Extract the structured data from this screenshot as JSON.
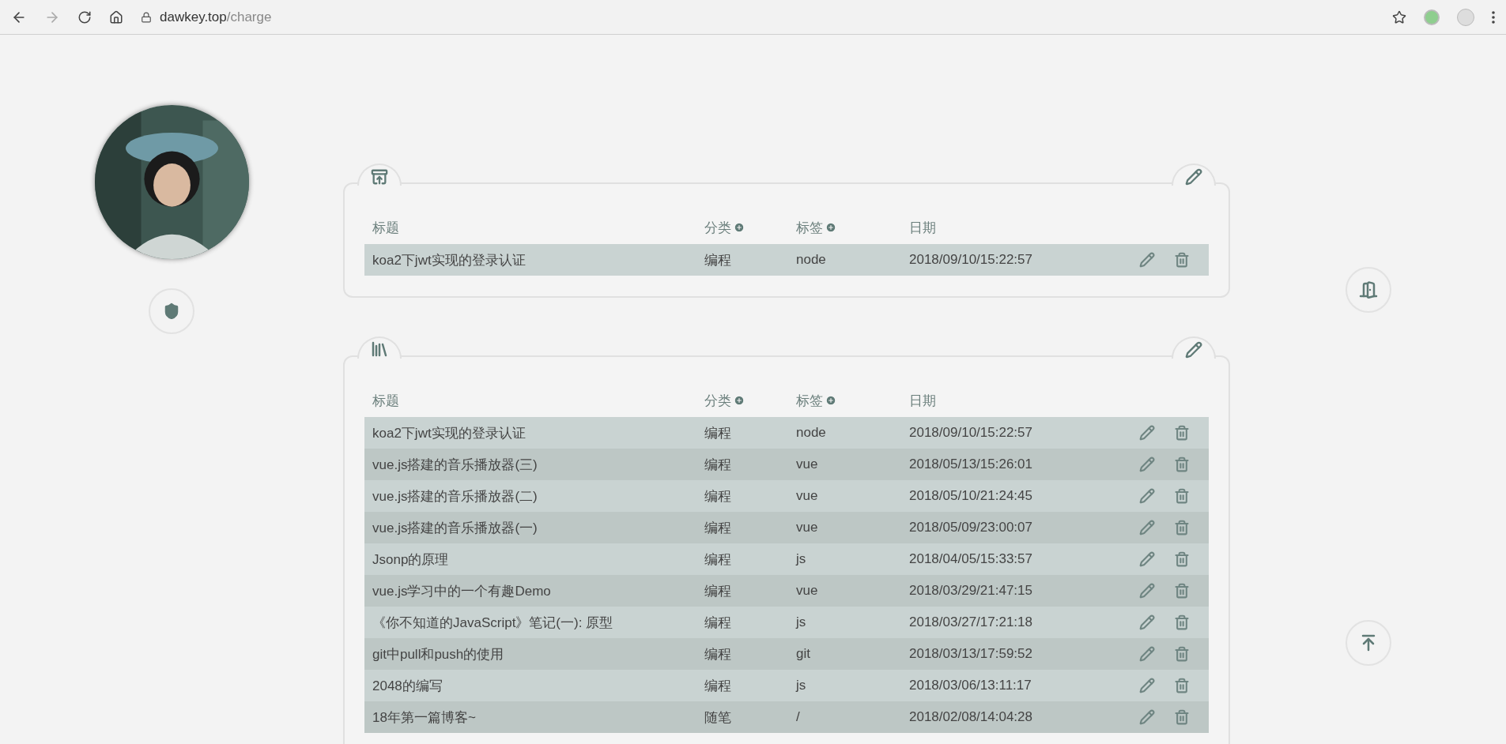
{
  "browser": {
    "host": "dawkey.top",
    "path": "/charge",
    "back_enabled": true,
    "forward_enabled": false
  },
  "cards": [
    {
      "kind": "recycle",
      "columns": [
        "标题",
        "分类",
        "标签",
        "日期"
      ],
      "rows": [
        {
          "title": "koa2下jwt实现的登录认证",
          "category": "编程",
          "tag": "node",
          "date": "2018/09/10/15:22:57"
        }
      ]
    },
    {
      "kind": "books",
      "columns": [
        "标题",
        "分类",
        "标签",
        "日期"
      ],
      "rows": [
        {
          "title": "koa2下jwt实现的登录认证",
          "category": "编程",
          "tag": "node",
          "date": "2018/09/10/15:22:57"
        },
        {
          "title": "vue.js搭建的音乐播放器(三)",
          "category": "编程",
          "tag": "vue",
          "date": "2018/05/13/15:26:01"
        },
        {
          "title": "vue.js搭建的音乐播放器(二)",
          "category": "编程",
          "tag": "vue",
          "date": "2018/05/10/21:24:45"
        },
        {
          "title": "vue.js搭建的音乐播放器(一)",
          "category": "编程",
          "tag": "vue",
          "date": "2018/05/09/23:00:07"
        },
        {
          "title": "Jsonp的原理",
          "category": "编程",
          "tag": "js",
          "date": "2018/04/05/15:33:57"
        },
        {
          "title": "vue.js学习中的一个有趣Demo",
          "category": "编程",
          "tag": "vue",
          "date": "2018/03/29/21:47:15"
        },
        {
          "title": "《你不知道的JavaScript》笔记(一): 原型",
          "category": "编程",
          "tag": "js",
          "date": "2018/03/27/17:21:18"
        },
        {
          "title": "git中pull和push的使用",
          "category": "编程",
          "tag": "git",
          "date": "2018/03/13/17:59:52"
        },
        {
          "title": "2048的编写",
          "category": "编程",
          "tag": "js",
          "date": "2018/03/06/13:11:17"
        },
        {
          "title": "18年第一篇博客~",
          "category": "随笔",
          "tag": "/",
          "date": "2018/02/08/14:04:28"
        }
      ]
    }
  ]
}
